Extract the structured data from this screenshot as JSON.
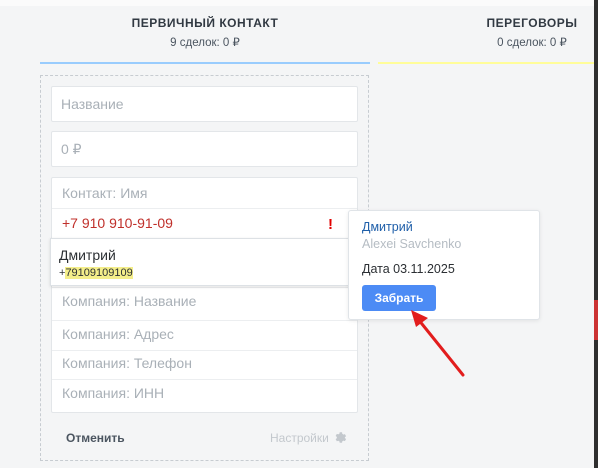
{
  "pipeline": {
    "columns": [
      {
        "title": "ПЕРВИЧНЫЙ КОНТАКТ",
        "subtitle": "9 сделок: 0 ₽",
        "accent": "#99ccfd"
      },
      {
        "title": "ПЕРЕГОВОРЫ",
        "subtitle": "0 сделок: 0 ₽",
        "accent": "#fffd99"
      }
    ]
  },
  "form": {
    "name_placeholder": "Название",
    "budget_placeholder": "0 ₽",
    "contact_name_placeholder": "Контакт: Имя",
    "contact_phone_value": "+7 910 910-91-09",
    "duplicate_warning": "!",
    "company_name_placeholder": "Компания: Название",
    "company_address_placeholder": "Компания: Адрес",
    "company_phone_placeholder": "Компания: Телефон",
    "company_inn_placeholder": "Компания: ИНН",
    "cancel_label": "Отменить",
    "settings_label": "Настройки",
    "settings_icon": "gear-icon"
  },
  "suggestion": {
    "name": "Дмитрий",
    "phone_prefix": "+",
    "phone_match": "79109109109"
  },
  "popover": {
    "contact_name": "Дмитрий",
    "responsible_user": "Alexei Savchenko",
    "date_text": "Дата 03.11.2025",
    "take_button": "Забрать",
    "button_color": "#4c8bf5"
  }
}
